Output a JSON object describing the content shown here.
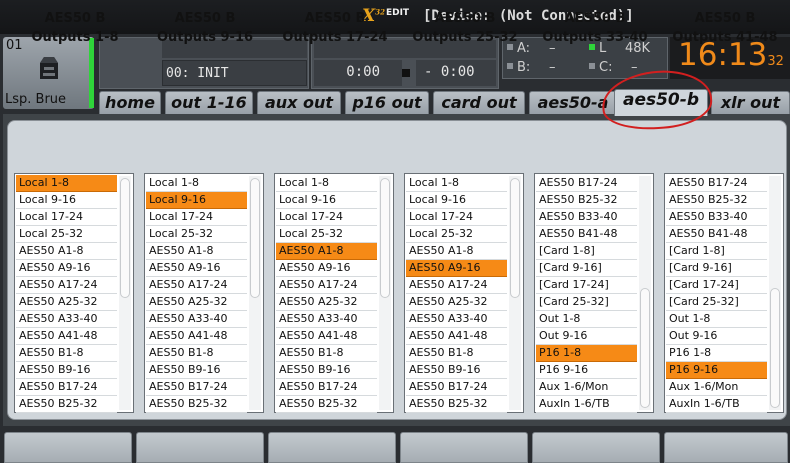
{
  "app": {
    "logo": "X",
    "logo_sup": "32",
    "logo_edit": "EDIT",
    "window_title": "[Device: (Not Connected)]"
  },
  "channel": {
    "number": "01",
    "name": "Lsp. Brue",
    "icon": "speaker-icon",
    "indicator_color": "#2fd43a"
  },
  "scene": {
    "label": "00: INIT"
  },
  "transport": {
    "time_elapsed": "0:00",
    "time_remaining": "- 0:00",
    "stop_icon": "stop-icon"
  },
  "io_status": {
    "a_label": "A:",
    "a_value": "–",
    "b_label": "B:",
    "b_value": "–",
    "l_label": "L",
    "l_value": "48K",
    "c_label": "C:",
    "c_value": "–"
  },
  "clock": {
    "time": "16:13",
    "seconds": "32"
  },
  "tabs": [
    {
      "label": "home",
      "active": false
    },
    {
      "label": "out 1-16",
      "active": false
    },
    {
      "label": "aux out",
      "active": false
    },
    {
      "label": "p16 out",
      "active": false
    },
    {
      "label": "card out",
      "active": false
    },
    {
      "label": "aes50-a",
      "active": false
    },
    {
      "label": "aes50-b",
      "active": true
    },
    {
      "label": "xlr out",
      "active": false
    }
  ],
  "columns": [
    {
      "title": "AES50 B",
      "subtitle": "Outputs 1-8",
      "selected": "Local 1-8",
      "items": [
        "Local 1-8",
        "Local 9-16",
        "Local 17-24",
        "Local 25-32",
        "AES50 A1-8",
        "AES50 A9-16",
        "AES50 A17-24",
        "AES50 A25-32",
        "AES50 A33-40",
        "AES50 A41-48",
        "AES50 B1-8",
        "AES50 B9-16",
        "AES50 B17-24",
        "AES50 B25-32"
      ]
    },
    {
      "title": "AES50 B",
      "subtitle": "Outputs 9-16",
      "selected": "Local 9-16",
      "items": [
        "Local 1-8",
        "Local 9-16",
        "Local 17-24",
        "Local 25-32",
        "AES50 A1-8",
        "AES50 A9-16",
        "AES50 A17-24",
        "AES50 A25-32",
        "AES50 A33-40",
        "AES50 A41-48",
        "AES50 B1-8",
        "AES50 B9-16",
        "AES50 B17-24",
        "AES50 B25-32"
      ]
    },
    {
      "title": "AES50 B",
      "subtitle": "Outputs 17-24",
      "selected": "AES50 A1-8",
      "items": [
        "Local 1-8",
        "Local 9-16",
        "Local 17-24",
        "Local 25-32",
        "AES50 A1-8",
        "AES50 A9-16",
        "AES50 A17-24",
        "AES50 A25-32",
        "AES50 A33-40",
        "AES50 A41-48",
        "AES50 B1-8",
        "AES50 B9-16",
        "AES50 B17-24",
        "AES50 B25-32"
      ]
    },
    {
      "title": "AES50 B",
      "subtitle": "Outputs 25-32",
      "selected": "AES50 A9-16",
      "items": [
        "Local 1-8",
        "Local 9-16",
        "Local 17-24",
        "Local 25-32",
        "AES50 A1-8",
        "AES50 A9-16",
        "AES50 A17-24",
        "AES50 A25-32",
        "AES50 A33-40",
        "AES50 A41-48",
        "AES50 B1-8",
        "AES50 B9-16",
        "AES50 B17-24",
        "AES50 B25-32"
      ]
    },
    {
      "title": "AES50 B",
      "subtitle": "Outputs 33-40",
      "selected": "P16 1-8",
      "items": [
        "AES50 B17-24",
        "AES50 B25-32",
        "AES50 B33-40",
        "AES50 B41-48",
        "[Card 1-8]",
        "[Card 9-16]",
        "[Card 17-24]",
        "[Card 25-32]",
        "Out 1-8",
        "Out 9-16",
        "P16 1-8",
        "P16 9-16",
        "Aux 1-6/Mon",
        "AuxIn 1-6/TB"
      ]
    },
    {
      "title": "AES50 B",
      "subtitle": "Outputs 41-48",
      "selected": "P16 9-16",
      "items": [
        "AES50 B17-24",
        "AES50 B25-32",
        "AES50 B33-40",
        "AES50 B41-48",
        "[Card 1-8]",
        "[Card 9-16]",
        "[Card 17-24]",
        "[Card 25-32]",
        "Out 1-8",
        "Out 9-16",
        "P16 1-8",
        "P16 9-16",
        "Aux 1-6/Mon",
        "AuxIn 1-6/TB"
      ]
    }
  ],
  "colors": {
    "accent": "#f68a16",
    "clock": "#f08a1a",
    "annotation": "#d21f1f"
  }
}
